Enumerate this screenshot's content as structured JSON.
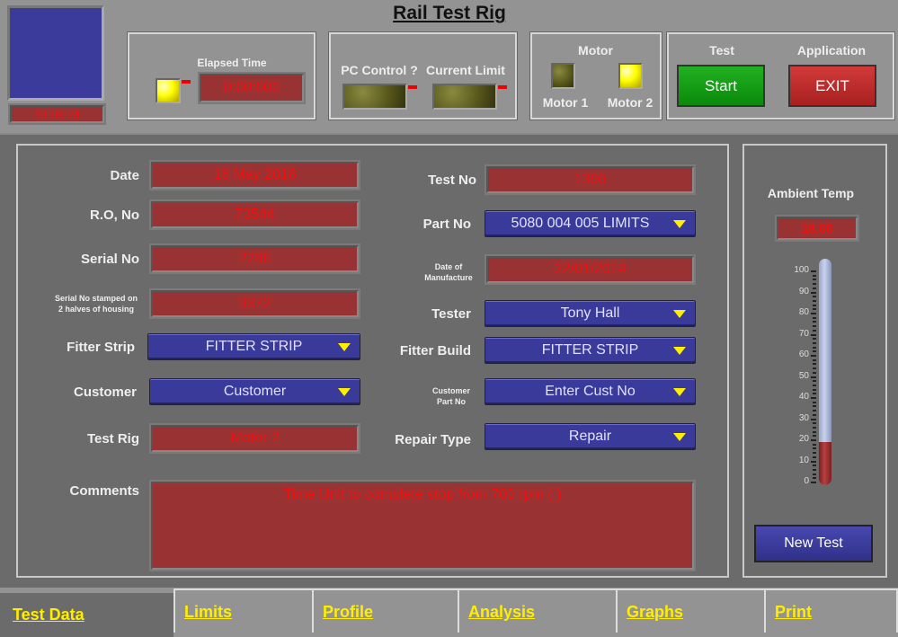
{
  "title": "Rail Test Rig",
  "clock": "13:09:24",
  "elapsed": {
    "label": "Elapsed Time",
    "value": "0:00:000"
  },
  "pc_control": {
    "label": "PC Control ?",
    "current_limit": "Current Limit"
  },
  "motor": {
    "label": "Motor",
    "motor1": "Motor 1",
    "motor2": "Motor 2",
    "motor1_on": false,
    "motor2_on": true
  },
  "test": {
    "label": "Test",
    "button": "Start"
  },
  "application": {
    "label": "Application",
    "button": "EXIT"
  },
  "form": {
    "date": {
      "label": "Date",
      "value": "16 May 2018"
    },
    "ro_no": {
      "label": "R.O, No",
      "value": "73544"
    },
    "serial_no": {
      "label": "Serial No",
      "value": "2286"
    },
    "serial_stamped": {
      "label1": "Serial No stamped on",
      "label2": "2 halves of housing",
      "value": "9372"
    },
    "fitter_strip": {
      "label": "Fitter Strip",
      "value": "FITTER STRIP"
    },
    "customer": {
      "label": "Customer",
      "value": "Customer"
    },
    "test_rig": {
      "label": "Test Rig",
      "value": "Motor 2"
    },
    "comments": {
      "label": "Comments",
      "value": "Time Unit to complete stop from 700 rpm (  )"
    },
    "test_no": {
      "label": "Test No",
      "value": "1396"
    },
    "part_no": {
      "label": "Part No",
      "value": "5080 004 005 LIMITS"
    },
    "date_manufacture": {
      "label1": "Date of",
      "label2": "Manufacture",
      "value": "22/01/2014"
    },
    "tester": {
      "label": "Tester",
      "value": "Tony Hall"
    },
    "fitter_build": {
      "label": "Fitter Build",
      "value": "FITTER STRIP"
    },
    "customer_part_no": {
      "label1": "Customer",
      "label2": "Part No",
      "value": "Enter Cust No"
    },
    "repair_type": {
      "label": "Repair Type",
      "value": "Repair"
    }
  },
  "ambient": {
    "label": "Ambient Temp",
    "value": "18.60",
    "level": 18.6,
    "scale_min": 0,
    "scale_max": 100,
    "ticks": [
      "100",
      "90",
      "80",
      "70",
      "60",
      "50",
      "40",
      "30",
      "20",
      "10",
      "0"
    ]
  },
  "new_test": "New Test",
  "tabs": [
    "Test Data",
    "Limits",
    "Profile",
    "Analysis",
    "Graphs",
    "Print"
  ],
  "colors": {
    "indicator_bg": "#993333",
    "indicator_text": "#f01010",
    "ring_bg": "#3a3a9a",
    "tab_text": "#ffee00"
  }
}
